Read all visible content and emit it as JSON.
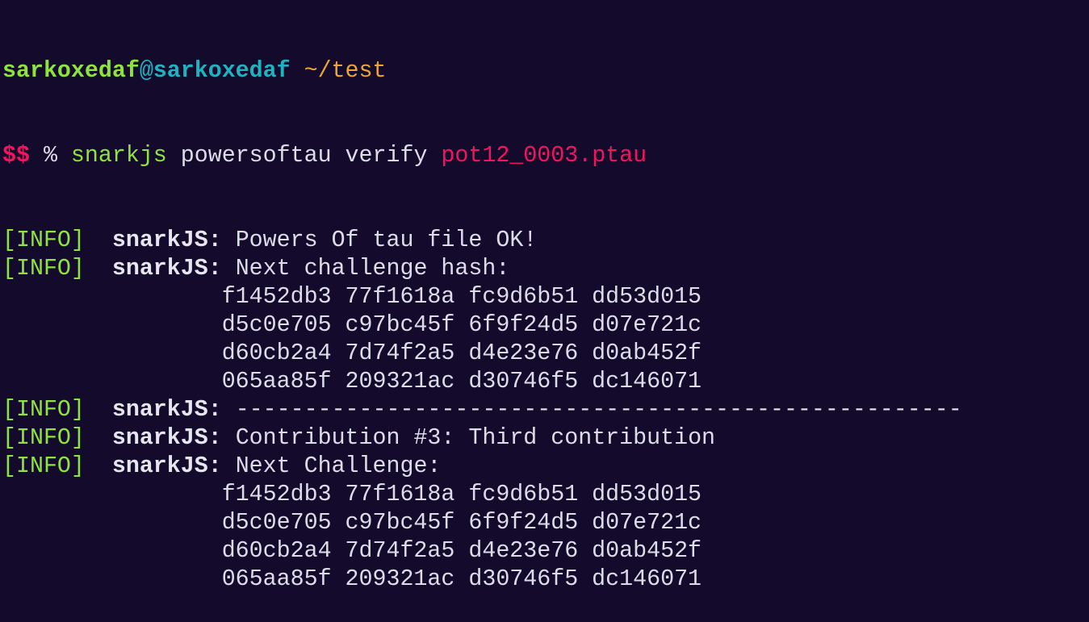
{
  "prompt": {
    "user": "sarkoxedaf",
    "at": "@",
    "host": "sarkoxedaf",
    "path": "~/test",
    "symbol": "$$",
    "percent": "%"
  },
  "command": {
    "text": "snarkjs",
    "args": "powersoftau verify",
    "file": "pot12_0003.ptau"
  },
  "log_tag": "[INFO]",
  "log_source": "snarkJS:",
  "lines": [
    {
      "type": "log",
      "message": "Powers Of tau file OK!"
    },
    {
      "type": "log",
      "message": "Next challenge hash:"
    },
    {
      "type": "hash",
      "message": "f1452db3 77f1618a fc9d6b51 dd53d015"
    },
    {
      "type": "hash",
      "message": "d5c0e705 c97bc45f 6f9f24d5 d07e721c"
    },
    {
      "type": "hash",
      "message": "d60cb2a4 7d74f2a5 d4e23e76 d0ab452f"
    },
    {
      "type": "hash",
      "message": "065aa85f 209321ac d30746f5 dc146071"
    },
    {
      "type": "log",
      "message": "-----------------------------------------------------"
    },
    {
      "type": "log",
      "message": "Contribution #3: Third contribution"
    },
    {
      "type": "log",
      "message": "Next Challenge:"
    },
    {
      "type": "hash",
      "message": "f1452db3 77f1618a fc9d6b51 dd53d015"
    },
    {
      "type": "hash",
      "message": "d5c0e705 c97bc45f 6f9f24d5 d07e721c"
    },
    {
      "type": "hash",
      "message": "d60cb2a4 7d74f2a5 d4e23e76 d0ab452f"
    },
    {
      "type": "hash",
      "message": "065aa85f 209321ac d30746f5 dc146071"
    }
  ],
  "colors": {
    "background": "#140a2c",
    "user": "#8ee43c",
    "host": "#1fb3bf",
    "path": "#eea534",
    "file": "#f2145c",
    "text": "#dcdde8"
  }
}
